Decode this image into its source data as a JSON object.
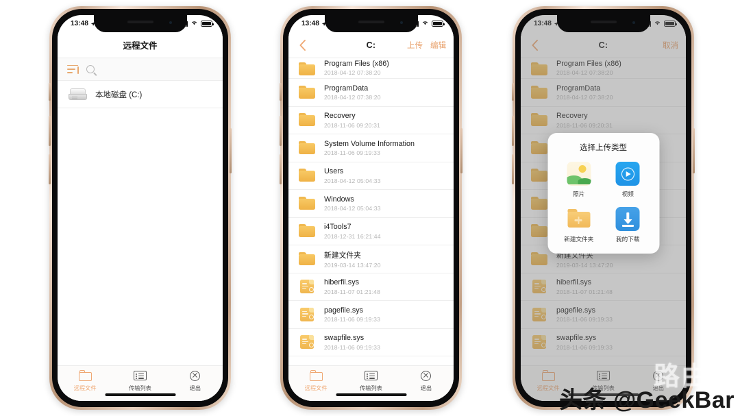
{
  "statusbar": {
    "time": "13:48",
    "location_icon": "location-arrow-icon",
    "signal_icon": "cellular-signal-icon",
    "wifi_icon": "wifi-icon",
    "battery_icon": "battery-icon"
  },
  "phone1": {
    "nav": {
      "title": "远程文件"
    },
    "toolbar": {
      "sort_icon": "sort-icon",
      "search_icon": "search-icon"
    },
    "drive": {
      "icon": "hard-drive-icon",
      "label": "本地磁盘 (C:)"
    }
  },
  "phone2": {
    "nav": {
      "back_icon": "chevron-left-icon",
      "title": "C:",
      "upload_label": "上传",
      "edit_label": "编辑"
    },
    "files": [
      {
        "name": "Program Files (x86)",
        "date": "2018-04-12 07:38:20",
        "kind": "folder",
        "clipped": true
      },
      {
        "name": "ProgramData",
        "date": "2018-04-12 07:38:20",
        "kind": "folder"
      },
      {
        "name": "Recovery",
        "date": "2018-11-06 09:20:31",
        "kind": "folder"
      },
      {
        "name": "System Volume Information",
        "date": "2018-11-06 09:19:33",
        "kind": "folder"
      },
      {
        "name": "Users",
        "date": "2018-04-12 05:04:33",
        "kind": "folder"
      },
      {
        "name": "Windows",
        "date": "2018-04-12 05:04:33",
        "kind": "folder"
      },
      {
        "name": "i4Tools7",
        "date": "2018-12-31 16:21:44",
        "kind": "folder"
      },
      {
        "name": "新建文件夹",
        "date": "2019-03-14 13:47:20",
        "kind": "folder"
      },
      {
        "name": "hiberfil.sys",
        "date": "2018-11-07 01:21:48",
        "kind": "file"
      },
      {
        "name": "pagefile.sys",
        "date": "2018-11-06 09:19:33",
        "kind": "file"
      },
      {
        "name": "swapfile.sys",
        "date": "2018-11-06 09:19:33",
        "kind": "file"
      }
    ]
  },
  "phone3": {
    "nav": {
      "back_icon": "chevron-left-icon",
      "title": "C:",
      "cancel_label": "取消"
    },
    "modal": {
      "title": "选择上传类型",
      "options": [
        {
          "label": "照片",
          "icon": "photo-landscape-icon"
        },
        {
          "label": "视频",
          "icon": "video-play-icon"
        },
        {
          "label": "新建文件夹",
          "icon": "new-folder-icon"
        },
        {
          "label": "我的下载",
          "icon": "download-icon"
        }
      ]
    }
  },
  "tabbar": {
    "items": [
      {
        "label": "远程文件",
        "icon": "remote-files-icon",
        "active": true
      },
      {
        "label": "传输列表",
        "icon": "transfer-list-icon",
        "active": false
      },
      {
        "label": "退出",
        "icon": "exit-icon",
        "active": false
      }
    ]
  },
  "watermark": {
    "ghost": "路由器",
    "main": "头条 @GeekBar"
  },
  "colors": {
    "accent": "#efa873",
    "folder": "#f1b959",
    "blue": "#2f8fdd",
    "frame": "#cbab93"
  }
}
